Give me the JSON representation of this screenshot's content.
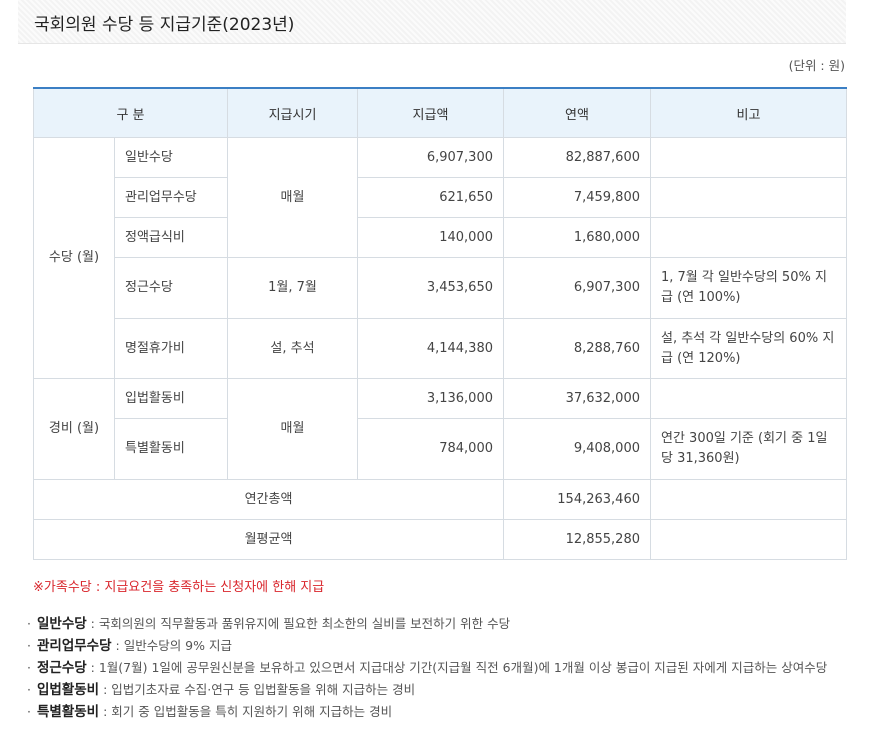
{
  "title": "국회의원 수당 등 지급기준(2023년)",
  "unit": "(단위 : 원)",
  "table": {
    "headers": [
      "구 분",
      "지급시기",
      "지급액",
      "연액",
      "비고"
    ],
    "group_allowance": "수당 (월)",
    "group_expense": "경비 (월)",
    "rows": [
      {
        "name": "일반수당",
        "timing": "",
        "amount": "6,907,300",
        "annual": "82,887,600",
        "note": ""
      },
      {
        "name": "관리업무수당",
        "timing": "매월",
        "amount": "621,650",
        "annual": "7,459,800",
        "note": ""
      },
      {
        "name": "정액급식비",
        "timing": "",
        "amount": "140,000",
        "annual": "1,680,000",
        "note": ""
      },
      {
        "name": "정근수당",
        "timing": "1월, 7월",
        "amount": "3,453,650",
        "annual": "6,907,300",
        "note": "1, 7월 각 일반수당의 50% 지급 (연 100%)"
      },
      {
        "name": "명절휴가비",
        "timing": "설, 추석",
        "amount": "4,144,380",
        "annual": "8,288,760",
        "note": "설, 추석 각 일반수당의 60% 지급 (연 120%)"
      },
      {
        "name": "입법활동비",
        "timing": "매월",
        "amount": "3,136,000",
        "annual": "37,632,000",
        "note": ""
      },
      {
        "name": "특별활동비",
        "timing": "",
        "amount": "784,000",
        "annual": "9,408,000",
        "note": "연간 300일 기준 (회기 중 1일당 31,360원)"
      }
    ],
    "total_label": "연간총액",
    "total_value": "154,263,460",
    "monthly_avg_label": "월평균액",
    "monthly_avg_value": "12,855,280"
  },
  "family_note": "※가족수당 : 지급요건을 충족하는 신청자에 한해 지급",
  "definitions": [
    {
      "term": "일반수당",
      "desc": " : 국회의원의 직무활동과 품위유지에 필요한 최소한의 실비를 보전하기 위한 수당"
    },
    {
      "term": "관리업무수당",
      "desc": " : 일반수당의 9% 지급"
    },
    {
      "term": "정근수당",
      "desc": " : 1월(7월) 1일에 공무원신분을 보유하고 있으면서 지급대상 기간(지급월 직전 6개월)에 1개월 이상 봉급이 지급된 자에게 지급하는 상여수당"
    },
    {
      "term": "입법활동비",
      "desc": " : 입법기초자료 수집·연구 등 입법활동을 위해 지급하는 경비"
    },
    {
      "term": "특별활동비",
      "desc": " : 회기 중 입법활동을 특히 지원하기 위해 지급하는 경비"
    }
  ]
}
